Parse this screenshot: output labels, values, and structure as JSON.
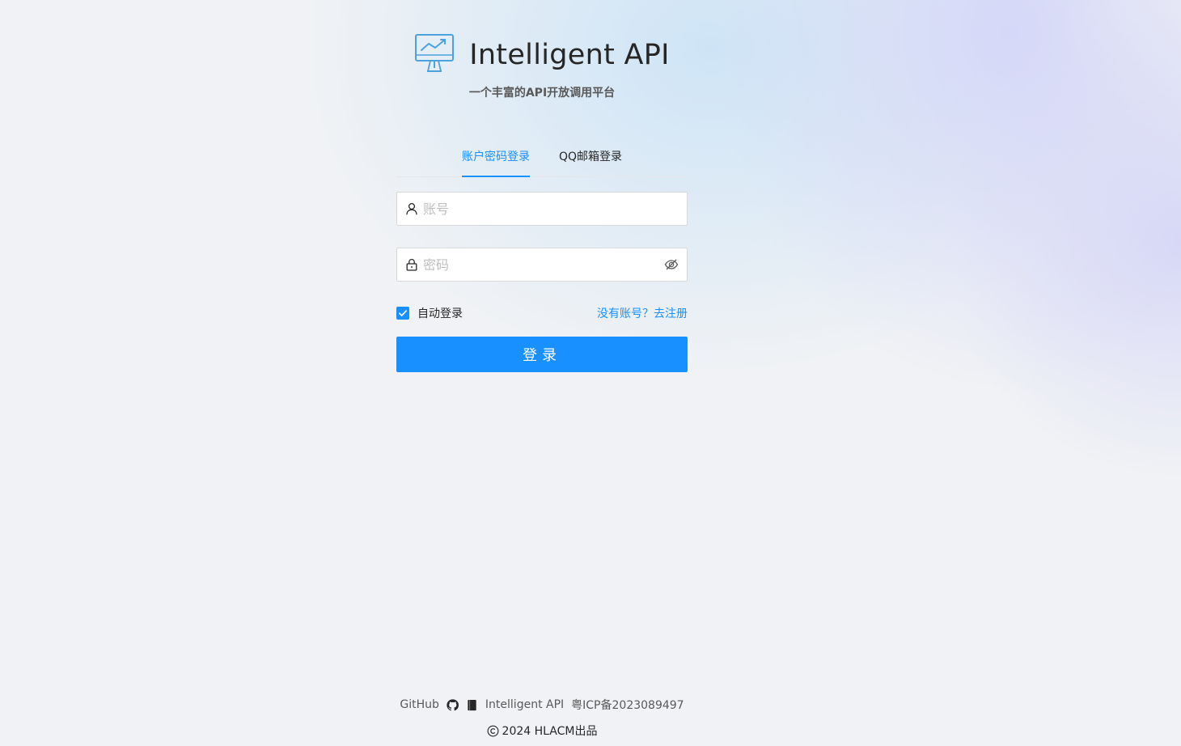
{
  "brand": {
    "title": "Intelligent API",
    "subtitle": "一个丰富的API开放调用平台",
    "logo_icon": "monitor-chart-icon"
  },
  "tabs": [
    {
      "label": "账户密码登录",
      "active": true
    },
    {
      "label": "QQ邮箱登录",
      "active": false
    }
  ],
  "form": {
    "account": {
      "placeholder": "账号",
      "value": "",
      "icon": "user-icon"
    },
    "password": {
      "placeholder": "密码",
      "value": "",
      "icon": "lock-icon",
      "toggle_icon": "eye-invisible-icon"
    },
    "auto_login": {
      "label": "自动登录",
      "checked": true
    },
    "register_link": "没有账号？去注册",
    "submit_label": "登录"
  },
  "footer": {
    "links": [
      {
        "label": "GitHub",
        "icon": null
      },
      {
        "label": "",
        "icon": "github-icon"
      },
      {
        "label": "",
        "icon": "book-icon"
      },
      {
        "label": "Intelligent API",
        "icon": null
      },
      {
        "label": "粤ICP备2023089497",
        "icon": null
      }
    ],
    "copyright": "2024 HLACM出品"
  },
  "colors": {
    "primary": "#1890ff",
    "background": "#f0f2f5"
  }
}
